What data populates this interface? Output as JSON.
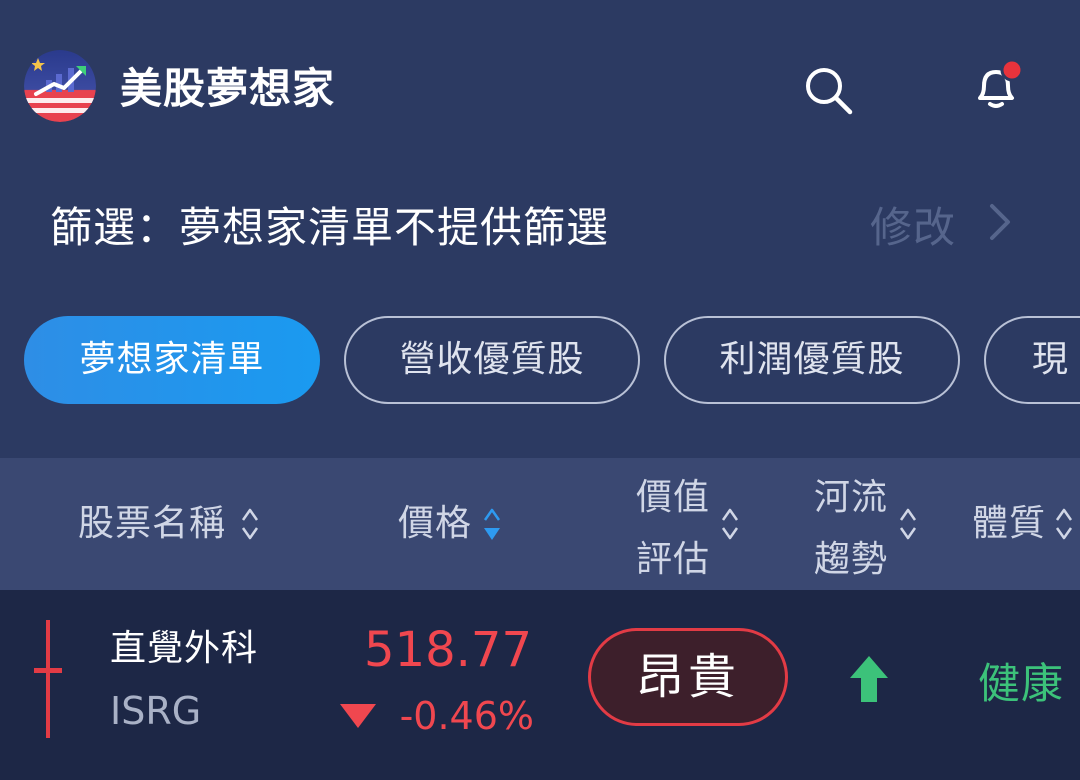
{
  "header": {
    "app_title": "美股夢想家"
  },
  "filter": {
    "text": "篩選：夢想家清單不提供篩選",
    "edit_label": "修改"
  },
  "chips": [
    {
      "label": "夢想家清單",
      "active": true
    },
    {
      "label": "營收優質股",
      "active": false
    },
    {
      "label": "利潤優質股",
      "active": false
    },
    {
      "label": "現",
      "active": false
    }
  ],
  "table": {
    "columns": {
      "name": "股票名稱",
      "price": "價格",
      "valuation_1": "價值",
      "valuation_2": "評估",
      "trend_1": "河流",
      "trend_2": "趨勢",
      "health": "體質"
    },
    "rows": [
      {
        "name": "直覺外科",
        "code": "ISRG",
        "price": "518.77",
        "change": "-0.46%",
        "valuation": "昂貴",
        "trend": "up",
        "health": "健康"
      }
    ]
  },
  "colors": {
    "background": "#2c3a62",
    "accent": "#1a9af0",
    "down_red": "#f0474f",
    "up_green": "#3cc27a",
    "notification_dot": "#e8333c"
  }
}
